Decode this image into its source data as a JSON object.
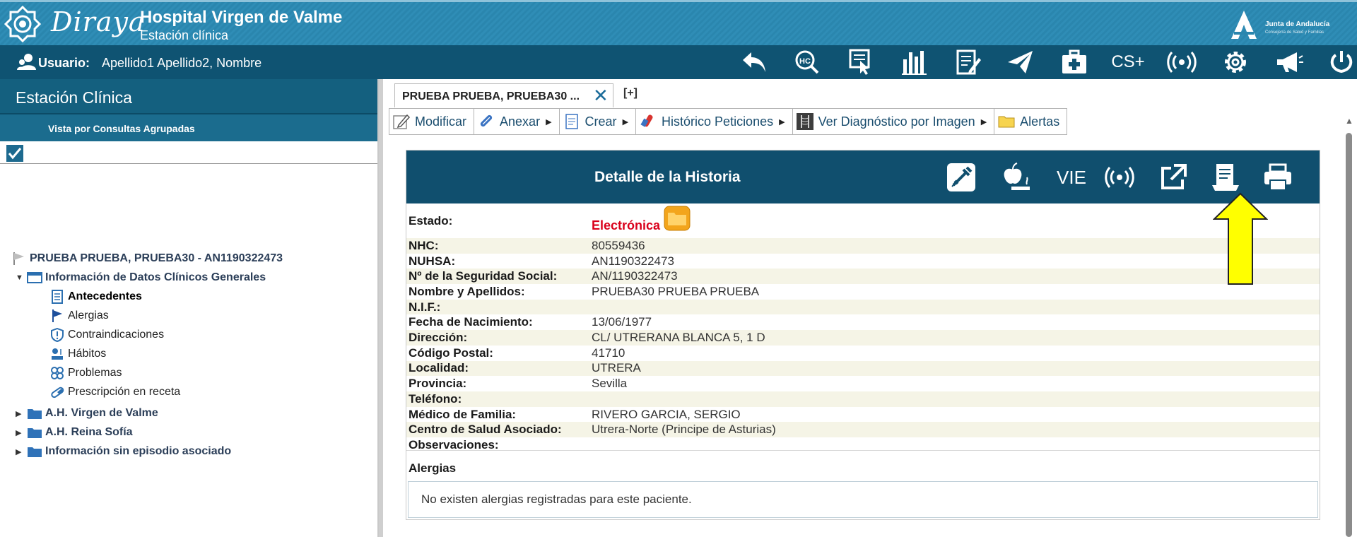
{
  "header": {
    "logo_text": "Diraya",
    "hospital_title": "Hospital Virgen de Valme",
    "subtitle": "Estación clínica",
    "junta_name": "Junta de Andalucía",
    "junta_sub": "Consejería de Salud y Familias"
  },
  "userbar": {
    "user_label": "Usuario:",
    "user_name": "Apellido1 Apellido2, Nombre",
    "tools": [
      {
        "icon": "back-arrow-icon"
      },
      {
        "icon": "hc-search-icon"
      },
      {
        "icon": "tablet-touch-icon"
      },
      {
        "icon": "bar-chart-icon"
      },
      {
        "icon": "edit-document-icon"
      },
      {
        "icon": "send-plane-icon"
      },
      {
        "icon": "medical-kit-icon"
      },
      {
        "icon": "cs-plus-icon",
        "label": "CS+"
      },
      {
        "icon": "broadcast-icon"
      },
      {
        "icon": "settings-icon"
      },
      {
        "icon": "megaphone-icon"
      },
      {
        "icon": "power-icon"
      }
    ]
  },
  "left_panel": {
    "title": "Estación Clínica",
    "subtitle": "Vista por Consultas Agrupadas",
    "patient": "PRUEBA PRUEBA, PRUEBA30 - AN1190322473",
    "group_general": "Información de Datos Clínicos Generales",
    "items": [
      {
        "label": "Antecedentes",
        "icon": "document-icon"
      },
      {
        "label": "Alergias",
        "icon": "flag-icon"
      },
      {
        "label": "Contraindicaciones",
        "icon": "shield-alert-icon"
      },
      {
        "label": "Hábitos",
        "icon": "habits-icon"
      },
      {
        "label": "Problemas",
        "icon": "problems-icon"
      },
      {
        "label": "Prescripción en receta",
        "icon": "pill-icon"
      }
    ],
    "folders": [
      "A.H. Virgen de Valme",
      "A.H. Reina Sofía",
      "Información sin episodio asociado"
    ]
  },
  "tabs": {
    "active_tab": "PRUEBA PRUEBA, PRUEBA30 ...",
    "add_tab": "[+]"
  },
  "actions": [
    "Modificar",
    "Anexar",
    "Crear",
    "Histórico Peticiones",
    "Ver Diagnóstico por Imagen",
    "Alertas"
  ],
  "detail": {
    "title": "Detalle de la Historia",
    "header_icons": [
      {
        "icon": "syringe-icon"
      },
      {
        "icon": "apple-smoking-icon"
      },
      {
        "icon": "vie-icon",
        "label": "VIE"
      },
      {
        "icon": "broadcast-icon"
      },
      {
        "icon": "external-link-icon"
      },
      {
        "icon": "report-icon"
      },
      {
        "icon": "print-icon"
      }
    ],
    "estado_label": "Estado:",
    "estado_value": "Electrónica",
    "fields": [
      {
        "label": "NHC:",
        "value": "80559436"
      },
      {
        "label": "NUHSA:",
        "value": "AN1190322473"
      },
      {
        "label": "Nº de la Seguridad Social:",
        "value": "AN/1190322473"
      },
      {
        "label": "Nombre y Apellidos:",
        "value": "PRUEBA30 PRUEBA PRUEBA"
      },
      {
        "label": "N.I.F.:",
        "value": ""
      },
      {
        "label": "Fecha de Nacimiento:",
        "value": "13/06/1977"
      },
      {
        "label": "Dirección:",
        "value": "CL/ UTRERANA BLANCA 5, 1 D"
      },
      {
        "label": "Código Postal:",
        "value": "41710"
      },
      {
        "label": "Localidad:",
        "value": "UTRERA"
      },
      {
        "label": "Provincia:",
        "value": "Sevilla"
      },
      {
        "label": "Teléfono:",
        "value": ""
      },
      {
        "label": "Médico de Familia:",
        "value": "RIVERO GARCIA, SERGIO"
      },
      {
        "label": "Centro de Salud Asociado:",
        "value": "Utrera-Norte (Principe de Asturias)"
      },
      {
        "label": "Observaciones:",
        "value": ""
      }
    ],
    "allergies_title": "Alergias",
    "allergies_text": "No existen alergias registradas para este paciente."
  },
  "colors": {
    "header_blue": "#2a86ae",
    "userbar_blue": "#0f5372",
    "panel_header": "#104f6e",
    "estado_red": "#d9001b",
    "annotation_yellow": "#ffff00"
  }
}
